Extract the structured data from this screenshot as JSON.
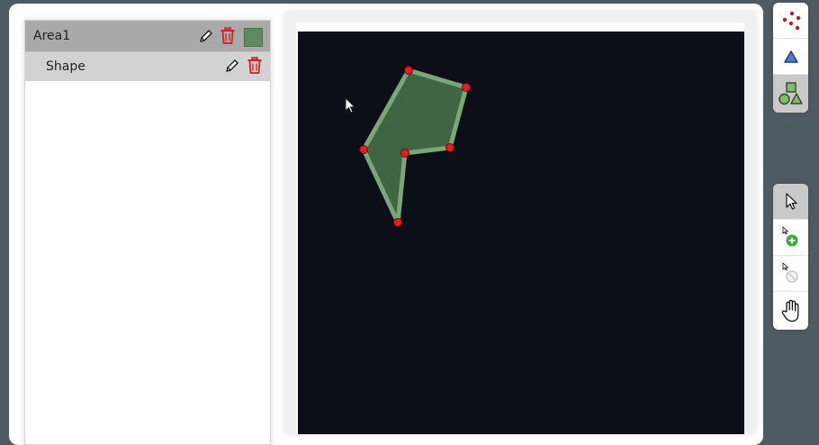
{
  "layers": {
    "area": {
      "label": "Area1",
      "color": "#5d8a5e",
      "icons": [
        "edit-icon",
        "trash-icon",
        "color-swatch"
      ]
    },
    "shape": {
      "label": "Shape",
      "icons": [
        "edit-icon",
        "trash-icon"
      ]
    }
  },
  "canvas": {
    "background": "#0c0f17",
    "polygon_fill": "#4e7a4f",
    "polygon_stroke": "#7aa67a",
    "vertex_color": "#e02020",
    "vertex_count": 6
  },
  "toolbar_top": [
    {
      "name": "points-tool",
      "icon": "red-dots-icon",
      "active": false
    },
    {
      "name": "triangle-tool",
      "icon": "blue-triangle-icon",
      "active": false
    },
    {
      "name": "shapes-tool",
      "icon": "green-shapes-icon",
      "active": true
    }
  ],
  "toolbar_bottom": [
    {
      "name": "select-tool",
      "icon": "cursor-icon",
      "active": true
    },
    {
      "name": "add-point-tool",
      "icon": "add-point-icon",
      "active": false
    },
    {
      "name": "remove-point-tool",
      "icon": "remove-point-icon",
      "active": false
    },
    {
      "name": "pan-tool",
      "icon": "hand-icon",
      "active": false
    }
  ]
}
